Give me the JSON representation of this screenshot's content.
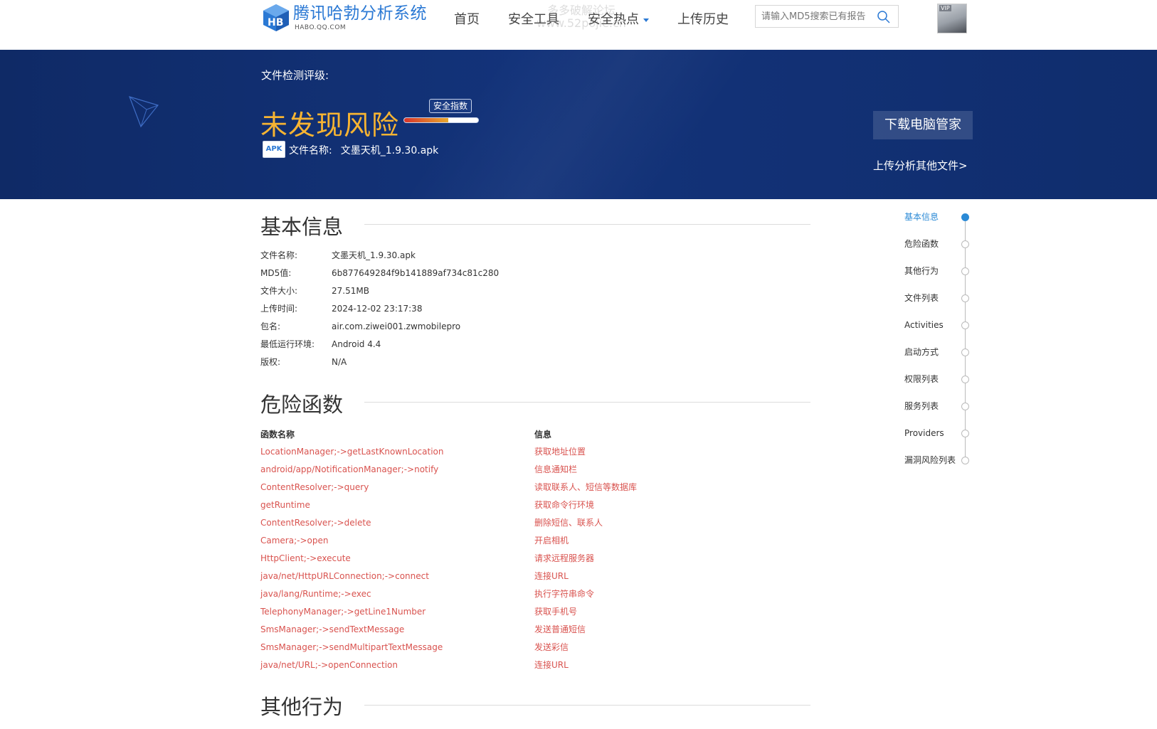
{
  "header": {
    "logo_title": "腾讯哈勃分析系统",
    "logo_sub": "HABO.QQ.COM",
    "nav": [
      "首页",
      "安全工具",
      "安全热点",
      "上传历史"
    ],
    "watermark_line1": "多多破解论坛",
    "watermark_line2": "www.52pojie.cn",
    "search_placeholder": "请输入MD5搜索已有报告",
    "avatar_badge": "VIP"
  },
  "banner": {
    "label": "文件检测评级:",
    "risk_title": "未发现风险",
    "index_label": "安全指数",
    "index_level": 0.6,
    "apk_icon_text": "APK",
    "file_label": "文件名称:",
    "file_name": "文墨天机_1.9.30.apk",
    "download_button": "下载电脑管家",
    "upload_link": "上传分析其他文件>"
  },
  "basic_info": {
    "title": "基本信息",
    "rows": [
      {
        "k": "文件名称:",
        "v": "文墨天机_1.9.30.apk"
      },
      {
        "k": "MD5值:",
        "v": "6b877649284f9b141889af734c81c280"
      },
      {
        "k": "文件大小:",
        "v": "27.51MB"
      },
      {
        "k": "上传时间:",
        "v": "2024-12-02 23:17:38"
      },
      {
        "k": "包名:",
        "v": "air.com.ziwei001.zwmobilepro"
      },
      {
        "k": "最低运行环境:",
        "v": "Android 4.4"
      },
      {
        "k": "版权:",
        "v": "N/A"
      }
    ]
  },
  "danger": {
    "title": "危险函数",
    "col_name": "函数名称",
    "col_info": "信息",
    "rows": [
      {
        "name": "LocationManager;->getLastKnownLocation",
        "info": "获取地址位置"
      },
      {
        "name": "android/app/NotificationManager;->notify",
        "info": "信息通知栏"
      },
      {
        "name": "ContentResolver;->query",
        "info": "读取联系人、短信等数据库"
      },
      {
        "name": "getRuntime",
        "info": "获取命令行环境"
      },
      {
        "name": "ContentResolver;->delete",
        "info": "删除短信、联系人"
      },
      {
        "name": "Camera;->open",
        "info": "开启相机"
      },
      {
        "name": "HttpClient;->execute",
        "info": "请求远程服务器"
      },
      {
        "name": "java/net/HttpURLConnection;->connect",
        "info": "连接URL"
      },
      {
        "name": "java/lang/Runtime;->exec",
        "info": "执行字符串命令"
      },
      {
        "name": "TelephonyManager;->getLine1Number",
        "info": "获取手机号"
      },
      {
        "name": "SmsManager;->sendTextMessage",
        "info": "发送普通短信"
      },
      {
        "name": "SmsManager;->sendMultipartTextMessage",
        "info": "发送彩信"
      },
      {
        "name": "java/net/URL;->openConnection",
        "info": "连接URL"
      }
    ]
  },
  "other": {
    "title": "其他行为"
  },
  "side_nav": {
    "items": [
      "基本信息",
      "危险函数",
      "其他行为",
      "文件列表",
      "Activities",
      "启动方式",
      "权限列表",
      "服务列表",
      "Providers",
      "漏洞风险列表"
    ],
    "active_index": 0
  },
  "colors": {
    "brand_blue": "#2b79d4",
    "banner_bg": "#13337a",
    "risk_orange": "#f7b432",
    "danger_red": "#d9534f",
    "active_nav": "#2b8ad6"
  }
}
